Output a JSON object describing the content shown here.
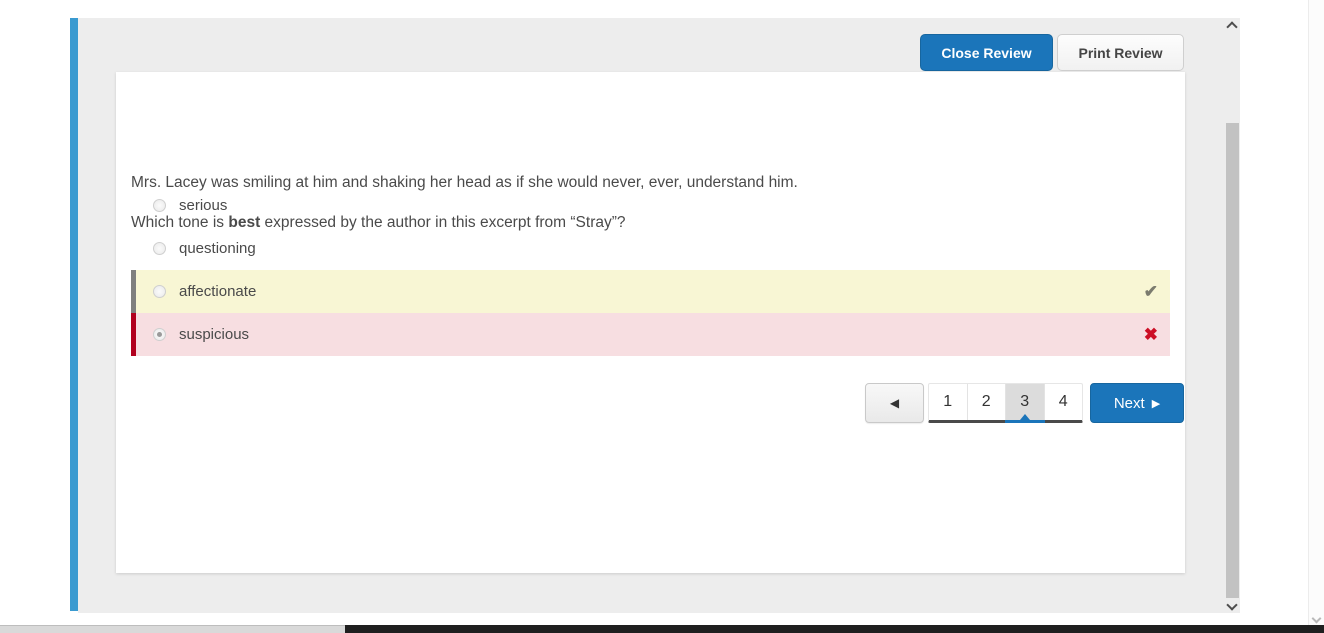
{
  "toolbar": {
    "close_label": "Close Review",
    "print_label": "Print Review"
  },
  "question": {
    "excerpt": "Mrs. Lacey was smiling at him and shaking her head as if she would never, ever, understand him.",
    "prompt_prefix": "Which tone is ",
    "prompt_bold": "best",
    "prompt_suffix": " expressed by the author in this excerpt from “Stray”?",
    "options": [
      {
        "label": "serious",
        "state": "none",
        "selected": false,
        "mark": ""
      },
      {
        "label": "questioning",
        "state": "none",
        "selected": false,
        "mark": ""
      },
      {
        "label": "affectionate",
        "state": "correct",
        "selected": false,
        "mark": "✔"
      },
      {
        "label": "suspicious",
        "state": "incorrect",
        "selected": true,
        "mark": "✖"
      }
    ]
  },
  "pagination": {
    "prev_icon": "◀",
    "pages": [
      "1",
      "2",
      "3",
      "4"
    ],
    "active_page": "3",
    "next_label": "Next",
    "next_icon": "▶"
  },
  "colors": {
    "accent_bar": "#3a9ad0",
    "primary_button": "#1b75ba",
    "content_background": "#ededed",
    "correct_row_bg": "#f8f6d4",
    "correct_row_border": "#7f7f7f",
    "incorrect_row_bg": "#f7dee1",
    "incorrect_row_border": "#b1001e",
    "check_icon": "#7b7b6e",
    "cross_icon": "#cc0e25"
  }
}
